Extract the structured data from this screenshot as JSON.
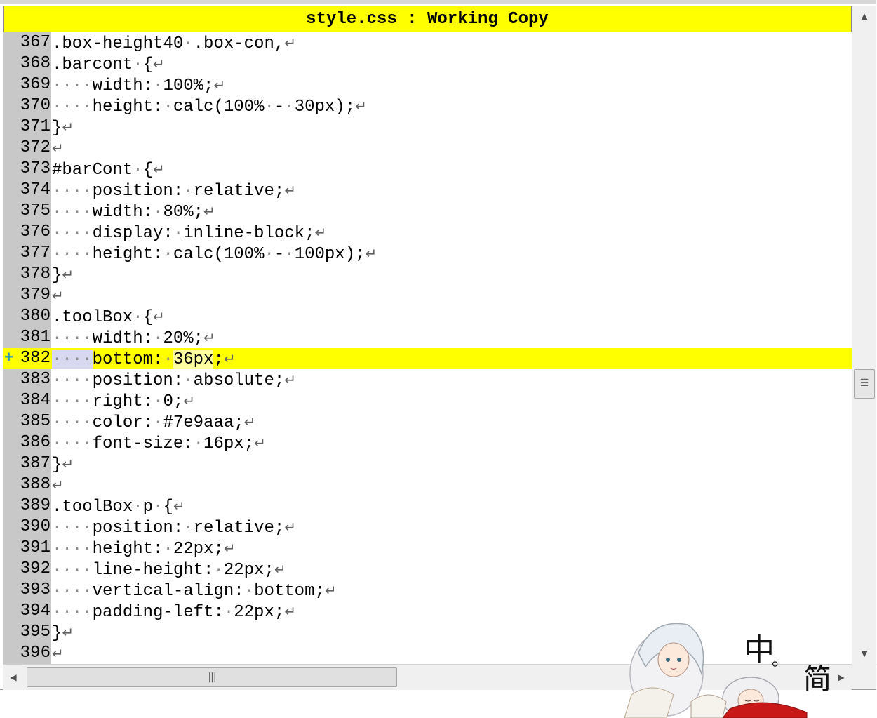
{
  "title": "style.css : Working Copy",
  "current_line": 382,
  "lines": [
    {
      "num": "367",
      "indent": 0,
      "text": ".box-height40·.box-con,"
    },
    {
      "num": "368",
      "indent": 0,
      "text": ".barcont·{"
    },
    {
      "num": "369",
      "indent": 1,
      "text": "width:·100%;"
    },
    {
      "num": "370",
      "indent": 1,
      "text": "height:·calc(100%·-·30px);"
    },
    {
      "num": "371",
      "indent": 0,
      "text": "}"
    },
    {
      "num": "372",
      "indent": 0,
      "text": ""
    },
    {
      "num": "373",
      "indent": 0,
      "text": "#barCont·{"
    },
    {
      "num": "374",
      "indent": 1,
      "text": "position:·relative;"
    },
    {
      "num": "375",
      "indent": 1,
      "text": "width:·80%;"
    },
    {
      "num": "376",
      "indent": 1,
      "text": "display:·inline-block;"
    },
    {
      "num": "377",
      "indent": 1,
      "text": "height:·calc(100%·-·100px);"
    },
    {
      "num": "378",
      "indent": 0,
      "text": "}"
    },
    {
      "num": "379",
      "indent": 0,
      "text": ""
    },
    {
      "num": "380",
      "indent": 0,
      "text": ".toolBox·{"
    },
    {
      "num": "381",
      "indent": 1,
      "text": "width:·20%;"
    },
    {
      "num": "382",
      "indent": 1,
      "text": "bottom:·36px;",
      "current": true,
      "hl_before": "bottom:·",
      "hl_word": "36px",
      "hl_after": ";"
    },
    {
      "num": "383",
      "indent": 1,
      "text": "position:·absolute;"
    },
    {
      "num": "384",
      "indent": 1,
      "text": "right:·0;"
    },
    {
      "num": "385",
      "indent": 1,
      "text": "color:·#7e9aaa;"
    },
    {
      "num": "386",
      "indent": 1,
      "text": "font-size:·16px;"
    },
    {
      "num": "387",
      "indent": 0,
      "text": "}"
    },
    {
      "num": "388",
      "indent": 0,
      "text": ""
    },
    {
      "num": "389",
      "indent": 0,
      "text": ".toolBox·p·{"
    },
    {
      "num": "390",
      "indent": 1,
      "text": "position:·relative;"
    },
    {
      "num": "391",
      "indent": 1,
      "text": "height:·22px;"
    },
    {
      "num": "392",
      "indent": 1,
      "text": "line-height:·22px;"
    },
    {
      "num": "393",
      "indent": 1,
      "text": "vertical-align:·bottom;"
    },
    {
      "num": "394",
      "indent": 1,
      "text": "padding-left:·22px;"
    },
    {
      "num": "395",
      "indent": 0,
      "text": "}"
    },
    {
      "num": "396",
      "indent": 0,
      "text": ""
    }
  ],
  "indent_marker": "····",
  "eol_glyph": "↵",
  "change_marker_icon": "plus-icon",
  "wallpaper_text": {
    "char1": "中",
    "dot": "。",
    "char2": "简"
  },
  "colors": {
    "title_bg": "#ffff00",
    "current_line_bg": "#ffff00",
    "gutter_bg": "#c8c8c8",
    "whitespace": "#8a8a8a"
  }
}
